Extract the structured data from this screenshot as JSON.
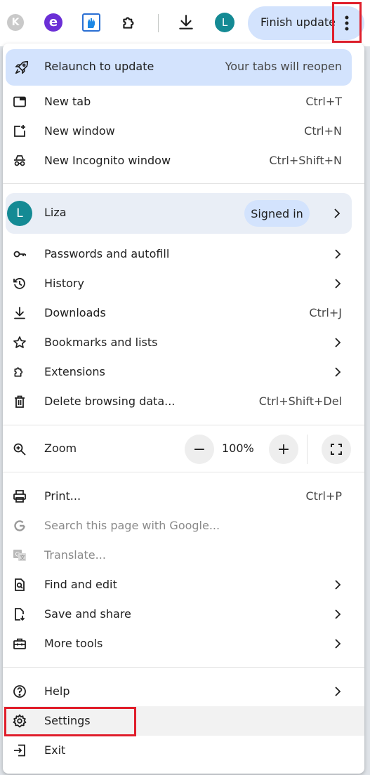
{
  "toolbar": {
    "extensions": [
      {
        "icon": "k-extension-icon",
        "letter": "K"
      },
      {
        "icon": "e-extension-icon",
        "letter": "e"
      },
      {
        "icon": "fist-extension-icon"
      },
      {
        "icon": "puzzle-extensions-icon"
      }
    ],
    "download_icon": "download-icon",
    "profile_initial": "L",
    "finish_update_label": "Finish update",
    "menu_icon": "three-dot-menu-icon",
    "colors": {
      "accent": "#d3e3fd",
      "avatar": "#148a94",
      "highlight": "#e01e2b"
    }
  },
  "menu": {
    "relaunch": {
      "label": "Relaunch to update",
      "note": "Your tabs will reopen",
      "icon": "rocket-icon"
    },
    "group1": [
      {
        "label": "New tab",
        "shortcut": "Ctrl+T",
        "icon": "new-tab-icon"
      },
      {
        "label": "New window",
        "shortcut": "Ctrl+N",
        "icon": "new-window-icon"
      },
      {
        "label": "New Incognito window",
        "shortcut": "Ctrl+Shift+N",
        "icon": "incognito-icon"
      }
    ],
    "profile": {
      "initial": "L",
      "name": "Liza",
      "status": "Signed in"
    },
    "group2": [
      {
        "label": "Passwords and autofill",
        "icon": "key-icon",
        "submenu": true
      },
      {
        "label": "History",
        "icon": "history-icon",
        "submenu": true
      },
      {
        "label": "Downloads",
        "shortcut": "Ctrl+J",
        "icon": "download-icon"
      },
      {
        "label": "Bookmarks and lists",
        "icon": "star-icon",
        "submenu": true
      },
      {
        "label": "Extensions",
        "icon": "puzzle-icon",
        "submenu": true
      },
      {
        "label": "Delete browsing data...",
        "shortcut": "Ctrl+Shift+Del",
        "icon": "trash-icon"
      }
    ],
    "zoom": {
      "label": "Zoom",
      "value": "100%",
      "minus": "−",
      "plus": "+",
      "icon": "zoom-icon"
    },
    "group3": [
      {
        "label": "Print...",
        "shortcut": "Ctrl+P",
        "icon": "print-icon"
      },
      {
        "label": "Search this page with Google...",
        "icon": "google-icon",
        "disabled": true
      },
      {
        "label": "Translate...",
        "icon": "translate-icon",
        "disabled": true
      },
      {
        "label": "Find and edit",
        "icon": "find-icon",
        "submenu": true
      },
      {
        "label": "Save and share",
        "icon": "save-share-icon",
        "submenu": true
      },
      {
        "label": "More tools",
        "icon": "toolbox-icon",
        "submenu": true
      }
    ],
    "group4": [
      {
        "label": "Help",
        "icon": "help-icon",
        "submenu": true
      },
      {
        "label": "Settings",
        "icon": "gear-icon",
        "hovered": true
      },
      {
        "label": "Exit",
        "icon": "exit-icon"
      }
    ]
  }
}
